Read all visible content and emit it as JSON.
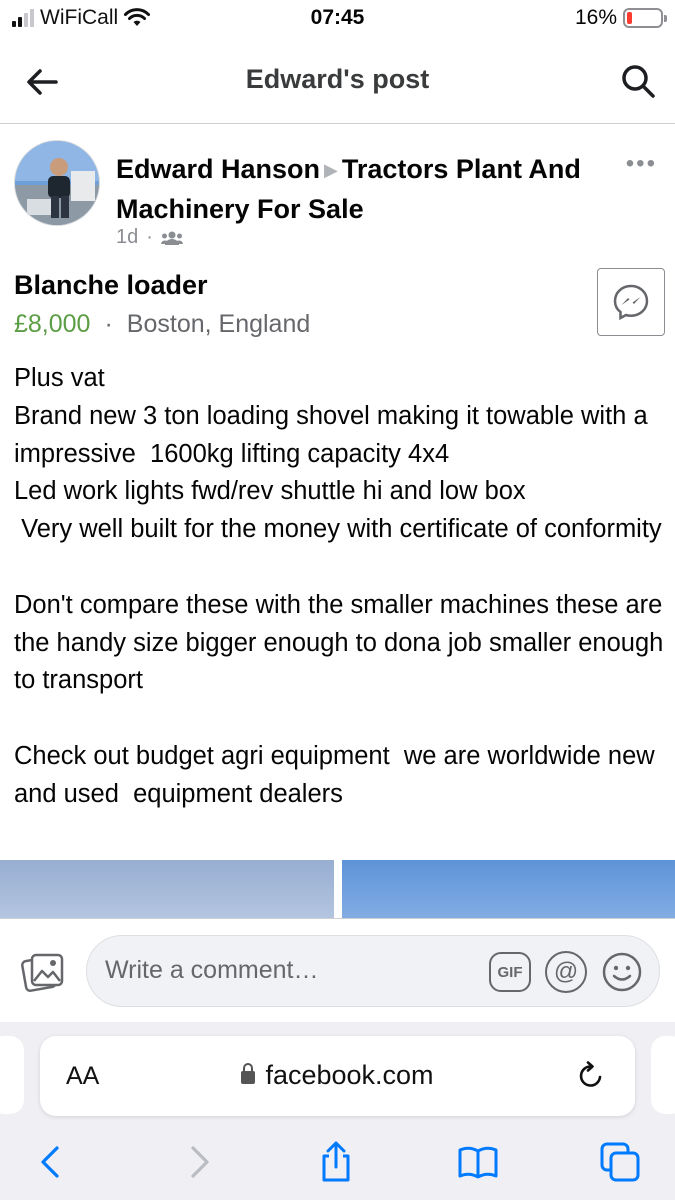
{
  "status_bar": {
    "carrier": "WiFiCall",
    "time": "07:45",
    "battery": "16%",
    "battery_level": 0.16
  },
  "nav": {
    "title": "Edward's post",
    "back_icon": "arrow-left-icon",
    "search_icon": "search-icon"
  },
  "post": {
    "author": "Edward Hanson",
    "group": "Tractors Plant And Machinery For Sale",
    "time": "1d",
    "audience_icon": "group-icon",
    "more_label": "•••"
  },
  "listing": {
    "title": "Blanche loader",
    "price": "£8,000",
    "separator": "·",
    "location": "Boston, England"
  },
  "description": "Plus vat\nBrand new 3 ton loading shovel making it towable with a impressive  1600kg lifting capacity 4x4\nLed work lights fwd/rev shuttle hi and low box\n Very well built for the money with certificate of conformity\n\nDon't compare these with the smaller machines these are the handy size bigger enough to dona job smaller enough to transport\n\nCheck out budget agri equipment  we are worldwide new and used  equipment dealers",
  "comment_bar": {
    "placeholder": "Write a comment…",
    "gif_label": "GIF",
    "mention_label": "@"
  },
  "browser": {
    "aa_label": "AA",
    "url": "facebook.com"
  },
  "colors": {
    "price_green": "#5c9e45",
    "muted_gray": "#65676b",
    "safari_blue": "#007aff",
    "battery_red": "#ff3b30"
  }
}
